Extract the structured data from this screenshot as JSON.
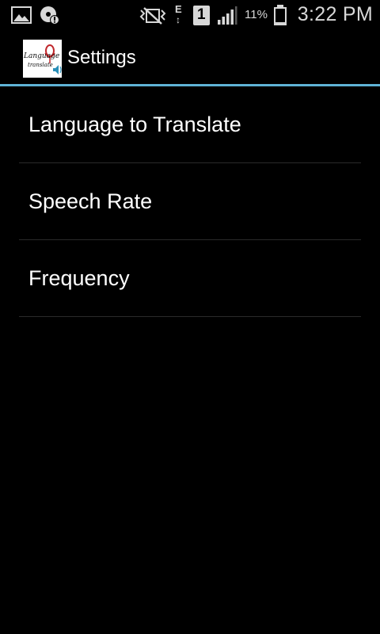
{
  "status_bar": {
    "time": "3:22 PM",
    "battery_percent": "11%",
    "network_type": "E",
    "sim_slot": "1",
    "icons": [
      "gallery-icon",
      "download-notification-icon",
      "mute-vibrate-icon",
      "data-arrows-icon",
      "sim-icon",
      "signal-icon",
      "battery-icon"
    ]
  },
  "action_bar": {
    "title": "Settings",
    "logo_text_line1": "Language",
    "logo_text_line2": "translate",
    "accent_color": "#5fb3d6"
  },
  "settings": {
    "items": [
      {
        "label": "Language to Translate"
      },
      {
        "label": "Speech Rate"
      },
      {
        "label": "Frequency"
      }
    ]
  }
}
